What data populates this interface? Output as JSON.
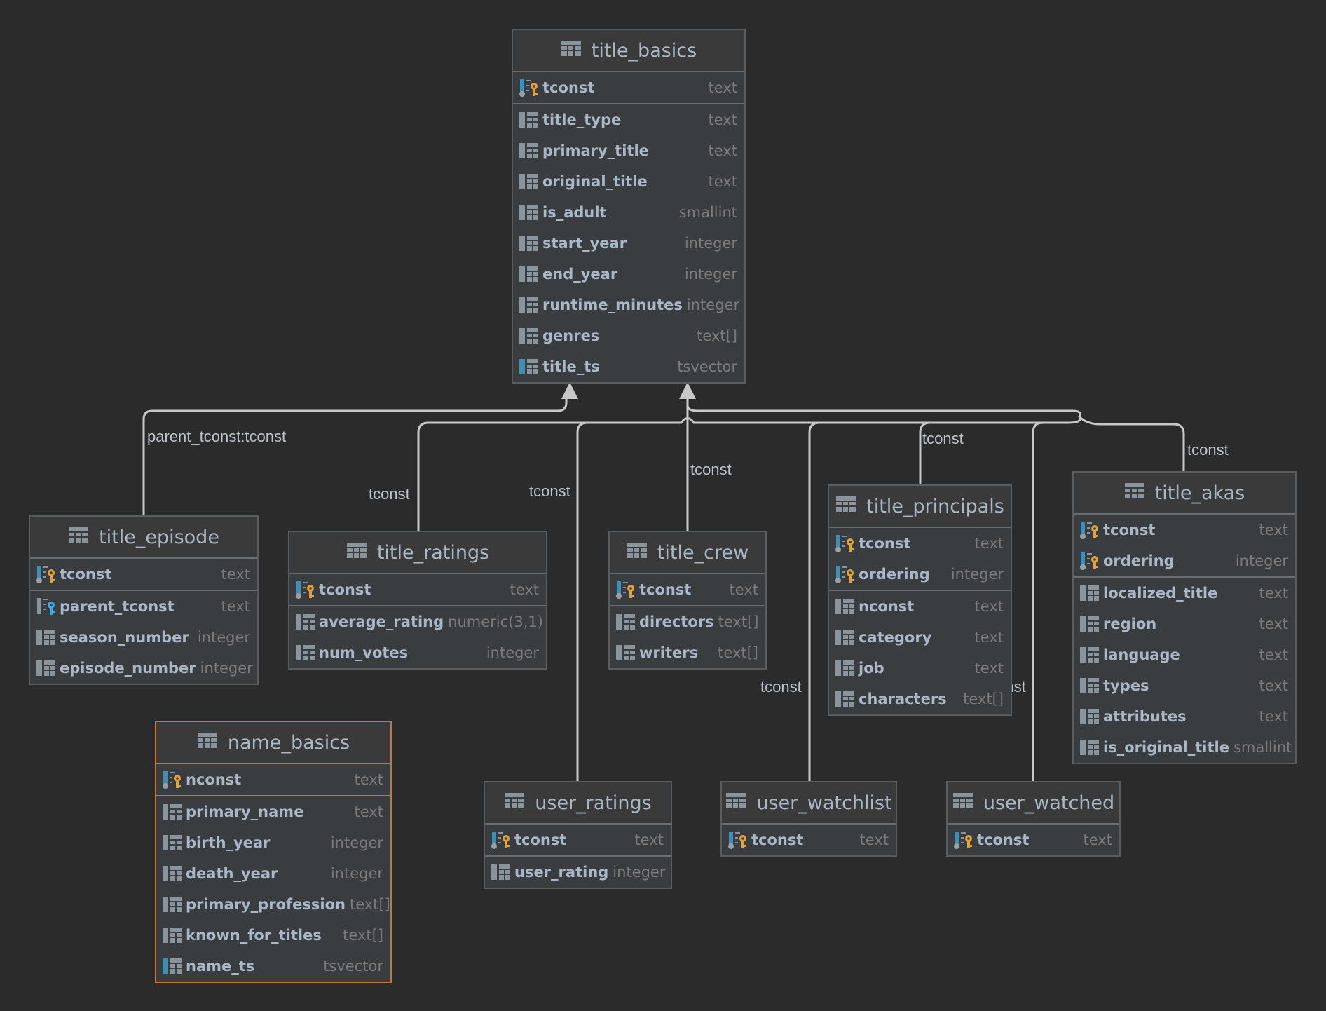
{
  "colors": {
    "background": "#2b2b2b",
    "table_body": "#3a3d40",
    "selected_border": "#c9772e",
    "pk_key": "#e0a33a",
    "fk_key": "#3ab0e0",
    "column_name": "#a9b7c6",
    "column_type": "#7a7a7a",
    "link": "#c8c8c8"
  },
  "tables": [
    {
      "name": "title_basics",
      "selected": false,
      "pk": [
        {
          "name": "tconst",
          "type": "text",
          "icon": "primary-key-icon"
        }
      ],
      "cols": [
        {
          "name": "title_type",
          "type": "text",
          "icon": "column-icon"
        },
        {
          "name": "primary_title",
          "type": "text",
          "icon": "column-icon"
        },
        {
          "name": "original_title",
          "type": "text",
          "icon": "column-icon"
        },
        {
          "name": "is_adult",
          "type": "smallint",
          "icon": "column-icon"
        },
        {
          "name": "start_year",
          "type": "integer",
          "icon": "column-icon"
        },
        {
          "name": "end_year",
          "type": "integer",
          "icon": "column-icon"
        },
        {
          "name": "runtime_minutes",
          "type": "integer",
          "icon": "column-icon"
        },
        {
          "name": "genres",
          "type": "text[]",
          "icon": "column-icon"
        },
        {
          "name": "title_ts",
          "type": "tsvector",
          "icon": "indexed-column-icon"
        }
      ]
    },
    {
      "name": "title_episode",
      "selected": false,
      "pk": [
        {
          "name": "tconst",
          "type": "text",
          "icon": "primary-key-icon"
        }
      ],
      "cols": [
        {
          "name": "parent_tconst",
          "type": "text",
          "icon": "foreign-key-icon"
        },
        {
          "name": "season_number",
          "type": "integer",
          "icon": "column-icon"
        },
        {
          "name": "episode_number",
          "type": "integer",
          "icon": "column-icon"
        }
      ]
    },
    {
      "name": "title_ratings",
      "selected": false,
      "pk": [
        {
          "name": "tconst",
          "type": "text",
          "icon": "primary-key-icon"
        }
      ],
      "cols": [
        {
          "name": "average_rating",
          "type": "numeric(3,1)",
          "icon": "column-icon"
        },
        {
          "name": "num_votes",
          "type": "integer",
          "icon": "column-icon"
        }
      ]
    },
    {
      "name": "title_crew",
      "selected": false,
      "pk": [
        {
          "name": "tconst",
          "type": "text",
          "icon": "primary-key-icon"
        }
      ],
      "cols": [
        {
          "name": "directors",
          "type": "text[]",
          "icon": "column-icon"
        },
        {
          "name": "writers",
          "type": "text[]",
          "icon": "column-icon"
        }
      ]
    },
    {
      "name": "title_principals",
      "selected": false,
      "pk": [
        {
          "name": "tconst",
          "type": "text",
          "icon": "primary-key-icon"
        },
        {
          "name": "ordering",
          "type": "integer",
          "icon": "primary-key-icon"
        }
      ],
      "cols": [
        {
          "name": "nconst",
          "type": "text",
          "icon": "column-icon"
        },
        {
          "name": "category",
          "type": "text",
          "icon": "column-icon"
        },
        {
          "name": "job",
          "type": "text",
          "icon": "column-icon"
        },
        {
          "name": "characters",
          "type": "text[]",
          "icon": "column-icon"
        }
      ]
    },
    {
      "name": "title_akas",
      "selected": false,
      "pk": [
        {
          "name": "tconst",
          "type": "text",
          "icon": "primary-key-icon"
        },
        {
          "name": "ordering",
          "type": "integer",
          "icon": "primary-key-icon"
        }
      ],
      "cols": [
        {
          "name": "localized_title",
          "type": "text",
          "icon": "column-icon"
        },
        {
          "name": "region",
          "type": "text",
          "icon": "column-icon"
        },
        {
          "name": "language",
          "type": "text",
          "icon": "column-icon"
        },
        {
          "name": "types",
          "type": "text",
          "icon": "column-icon"
        },
        {
          "name": "attributes",
          "type": "text",
          "icon": "column-icon"
        },
        {
          "name": "is_original_title",
          "type": "smallint",
          "icon": "column-icon"
        }
      ]
    },
    {
      "name": "name_basics",
      "selected": true,
      "pk": [
        {
          "name": "nconst",
          "type": "text",
          "icon": "primary-key-icon"
        }
      ],
      "cols": [
        {
          "name": "primary_name",
          "type": "text",
          "icon": "column-icon"
        },
        {
          "name": "birth_year",
          "type": "integer",
          "icon": "column-icon"
        },
        {
          "name": "death_year",
          "type": "integer",
          "icon": "column-icon"
        },
        {
          "name": "primary_profession",
          "type": "text[]",
          "icon": "column-icon"
        },
        {
          "name": "known_for_titles",
          "type": "text[]",
          "icon": "column-icon"
        },
        {
          "name": "name_ts",
          "type": "tsvector",
          "icon": "indexed-column-icon"
        }
      ]
    },
    {
      "name": "user_ratings",
      "selected": false,
      "pk": [
        {
          "name": "tconst",
          "type": "text",
          "icon": "primary-key-icon"
        }
      ],
      "cols": [
        {
          "name": "user_rating",
          "type": "integer",
          "icon": "column-icon"
        }
      ]
    },
    {
      "name": "user_watchlist",
      "selected": false,
      "pk": [
        {
          "name": "tconst",
          "type": "text",
          "icon": "primary-key-icon"
        }
      ],
      "cols": []
    },
    {
      "name": "user_watched",
      "selected": false,
      "pk": [
        {
          "name": "tconst",
          "type": "text",
          "icon": "primary-key-icon"
        }
      ],
      "cols": []
    }
  ],
  "links": [
    {
      "from": "title_episode",
      "to": "title_basics",
      "label": "parent_tconst:tconst"
    },
    {
      "from": "title_ratings",
      "to": "title_basics",
      "label": "tconst"
    },
    {
      "from": "user_ratings",
      "to": "title_basics",
      "label": "tconst"
    },
    {
      "from": "title_crew",
      "to": "title_basics",
      "label": "tconst"
    },
    {
      "from": "title_principals",
      "to": "title_basics",
      "label": "tconst"
    },
    {
      "from": "title_akas",
      "to": "title_basics",
      "label": "tconst"
    },
    {
      "from": "user_watchlist",
      "to": "title_basics",
      "label": "tconst"
    },
    {
      "from": "user_watched",
      "to": "title_basics",
      "label": "tconst"
    }
  ]
}
